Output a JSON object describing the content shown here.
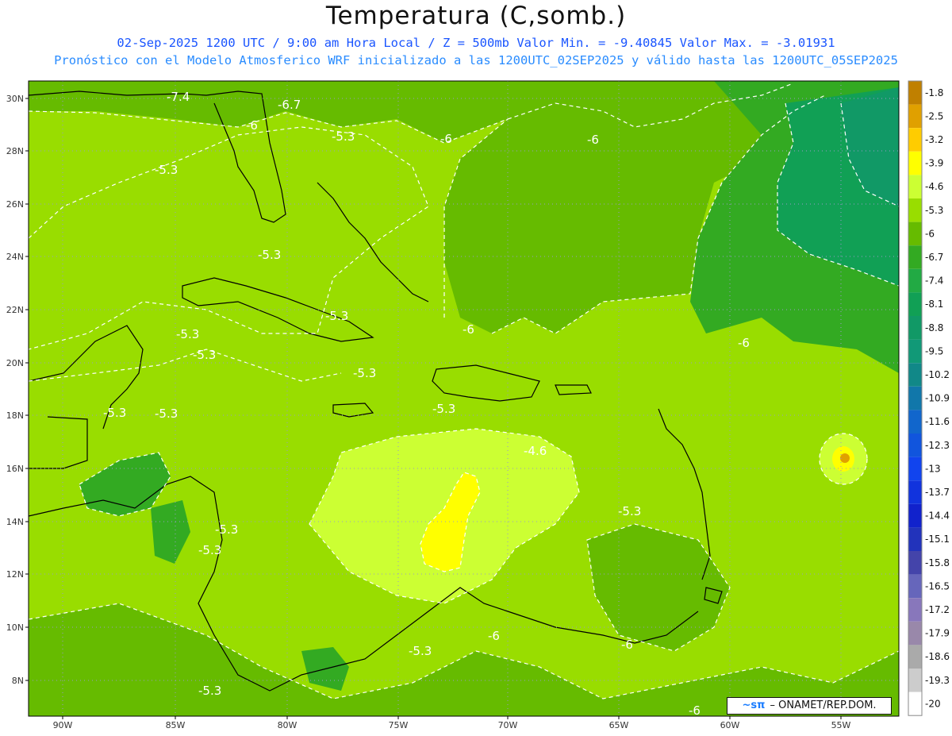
{
  "title": "Temperatura (C,somb.)",
  "subtitle_line1": "02-Sep-2025  1200 UTC / 9:00 am Hora Local / Z = 500mb  Valor Min. = -9.40845  Valor Max. = -3.01931",
  "subtitle_line2": "Pronóstico con el Modelo Atmosferico WRF inicializado a las 1200UTC_02SEP2025 y válido hasta las  1200UTC_05SEP2025",
  "credit": {
    "logo_text": "~sπ",
    "text": "ONAMET/REP.DOM."
  },
  "axes": {
    "lon_ticks": [
      "90W",
      "85W",
      "80W",
      "75W",
      "70W",
      "65W",
      "60W",
      "55W"
    ],
    "lat_ticks": [
      "30N",
      "28N",
      "26N",
      "24N",
      "22N",
      "20N",
      "18N",
      "16N",
      "14N",
      "12N",
      "10N",
      "8N"
    ]
  },
  "colorbar": {
    "labels": [
      "-1.8",
      "-2.5",
      "-3.2",
      "-3.9",
      "-4.6",
      "-5.3",
      "-6",
      "-6.7",
      "-7.4",
      "-8.1",
      "-8.8",
      "-9.5",
      "-10.2",
      "-10.9",
      "-11.6",
      "-12.3",
      "-13",
      "-13.7",
      "-14.4",
      "-15.1",
      "-15.8",
      "-16.5",
      "-17.2",
      "-17.9",
      "-18.6",
      "-19.3",
      "-20"
    ],
    "colors": [
      "#c08000",
      "#e0a000",
      "#ffcc00",
      "#ffff00",
      "#ccff33",
      "#99dd00",
      "#66bb00",
      "#33aa22",
      "#22aa44",
      "#11a055",
      "#119966",
      "#119977",
      "#118888",
      "#1177aa",
      "#1166cc",
      "#1155dd",
      "#1144ee",
      "#1133dd",
      "#1122cc",
      "#2233bb",
      "#4444aa",
      "#6666bb",
      "#8877bb",
      "#9988aa",
      "#aaaaaa",
      "#cccccc",
      "#ffffff"
    ]
  },
  "contour_labels": [
    "-7.4",
    "-6.7",
    "-6",
    "-5.3",
    "-6",
    "-6",
    "-5.3",
    "-5.3",
    "-5.3",
    "-5.3",
    "-6",
    "-5.3",
    "-5.3",
    "-6",
    "-5.3",
    "-5.3",
    "-4.6",
    "-5.3",
    "-5.3",
    "-5.3",
    "-5.3",
    "-6",
    "-5.3",
    "-6",
    "-5.3",
    "-6"
  ],
  "palette": {
    "bg_lightest": "#ccff33",
    "bg_light": "#99dd00",
    "bg_mid": "#66bb00",
    "bg_dark": "#33aa22",
    "bg_darker": "#11a055",
    "bg_darkest": "#119966",
    "yellow": "#ffff00",
    "gold": "#ffcc00",
    "orange": "#e0a000"
  }
}
